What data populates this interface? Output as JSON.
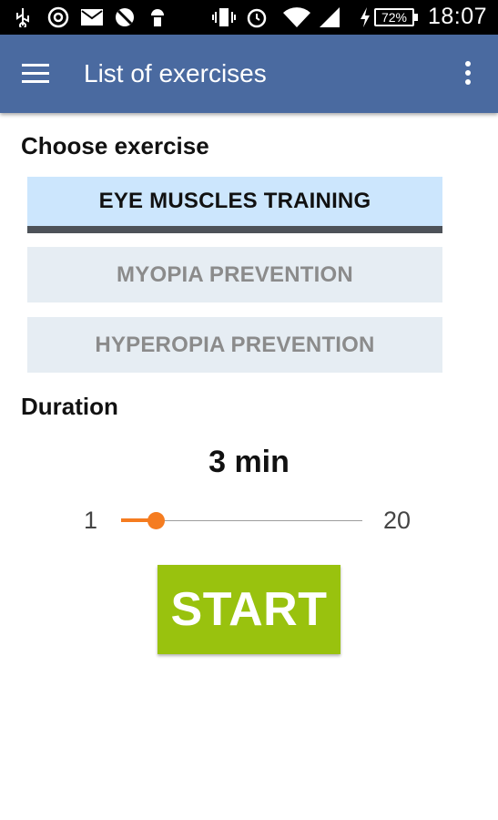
{
  "status_bar": {
    "icons": [
      "usb-icon",
      "at-icon",
      "mail-icon",
      "sync-off-icon",
      "android-icon",
      "vibrate-icon",
      "alarm-icon",
      "wifi-icon",
      "signal-icon",
      "charging-icon"
    ],
    "battery": "72%",
    "time": "18:07"
  },
  "appbar": {
    "title": "List of exercises",
    "menu_icon": "hamburger-menu-icon",
    "overflow_icon": "more-vert-icon",
    "color": "#4a6aa0"
  },
  "exercise_section": {
    "title": "Choose exercise",
    "options": [
      {
        "label": "EYE MUSCLES TRAINING",
        "selected": true
      },
      {
        "label": "MYOPIA PREVENTION",
        "selected": false
      },
      {
        "label": "HYPEROPIA PREVENTION",
        "selected": false
      }
    ]
  },
  "duration_section": {
    "title": "Duration",
    "value_label": "3 min",
    "min_label": "1",
    "max_label": "20",
    "min": 1,
    "max": 20,
    "value": 3,
    "accent": "#f57c20"
  },
  "start_button": {
    "label": "START",
    "color": "#99c20e"
  }
}
